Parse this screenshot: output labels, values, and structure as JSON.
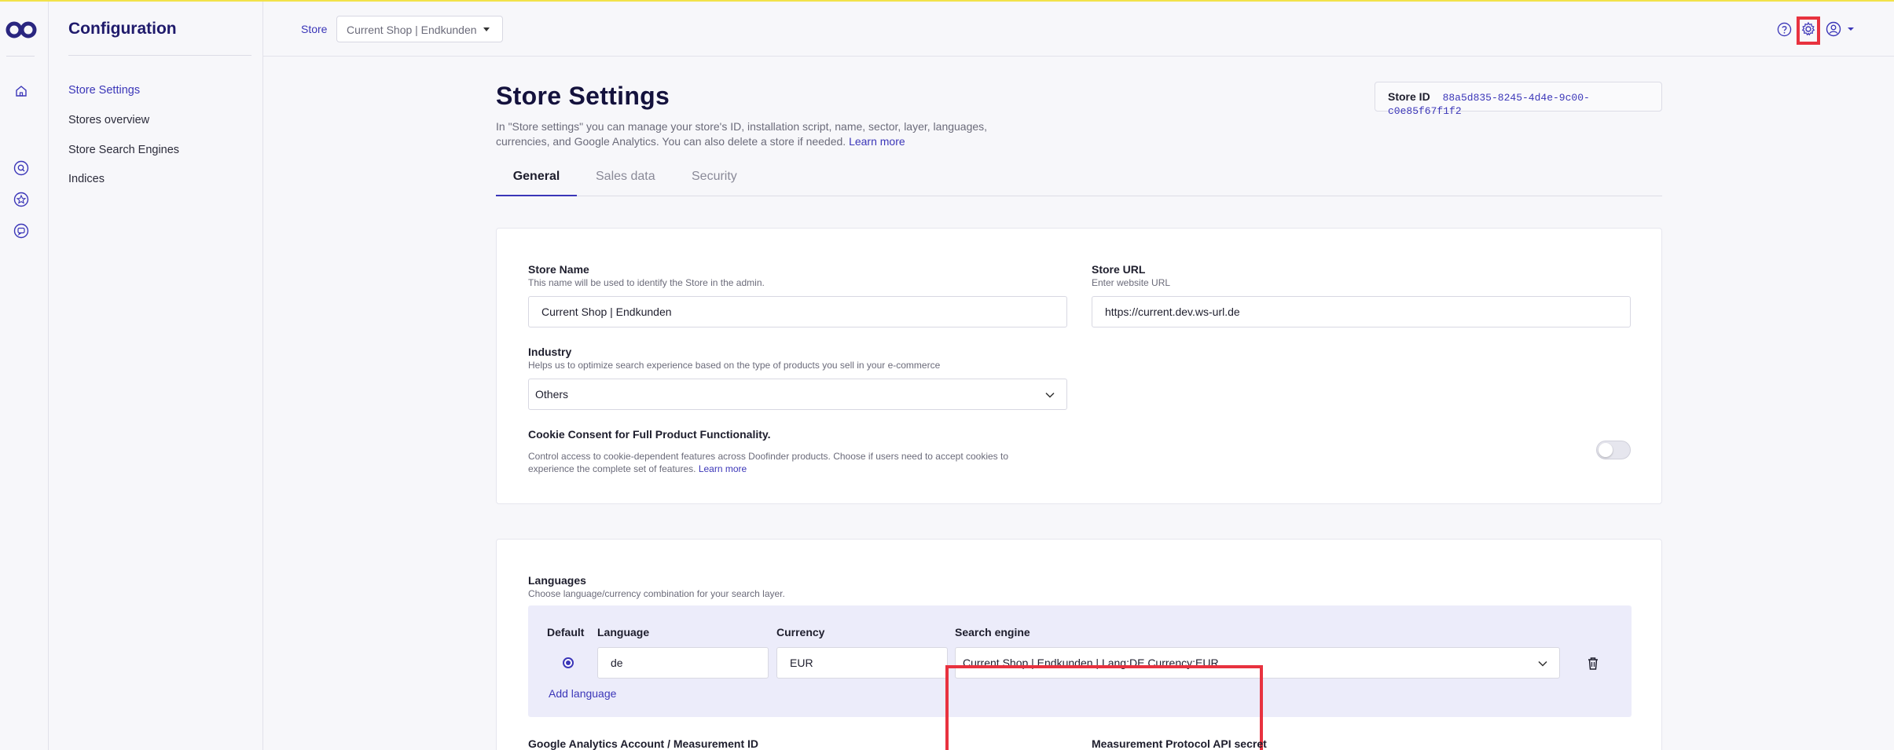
{
  "sidebar_title": "Configuration",
  "sidebar_items": [
    "Store Settings",
    "Stores overview",
    "Store Search Engines",
    "Indices"
  ],
  "header": {
    "store_label": "Store",
    "store_selected": "Current Shop | Endkunden"
  },
  "page": {
    "title": "Store Settings",
    "description": "In \"Store settings\" you can manage your store's ID, installation script, name, sector, layer, languages, currencies, and Google Analytics. You can also delete a store if needed.",
    "learn_more": "Learn more",
    "store_id_label": "Store ID",
    "store_id_value": "88a5d835-8245-4d4e-9c00-c0e85f67f1f2",
    "tabs": [
      "General",
      "Sales data",
      "Security"
    ]
  },
  "general": {
    "store_name_label": "Store Name",
    "store_name_hint": "This name will be used to identify the Store in the admin.",
    "store_name_value": "Current Shop | Endkunden",
    "store_url_label": "Store URL",
    "store_url_hint": "Enter website URL",
    "store_url_value": "https://current.dev.ws-url.de",
    "industry_label": "Industry",
    "industry_hint": "Helps us to optimize search experience based on the type of products you sell in your e-commerce",
    "industry_value": "Others",
    "cookie_label": "Cookie Consent for Full Product Functionality.",
    "cookie_hint_line1": "Control access to cookie-dependent features across Doofinder products. Choose if users need to accept cookies to",
    "cookie_hint_line2": "experience the complete set of features.",
    "cookie_learn_more": "Learn more"
  },
  "languages": {
    "label": "Languages",
    "hint": "Choose language/currency combination for your search layer.",
    "col_default": "Default",
    "col_language": "Language",
    "col_currency": "Currency",
    "col_search_engine": "Search engine",
    "language_value": "de",
    "currency_value": "EUR",
    "search_engine_value": "Current Shop | Endkunden | Lang:DE Currency:EUR",
    "add_language": "Add language"
  },
  "analytics": {
    "ga_label": "Google Analytics Account / Measurement ID",
    "mp_label": "Measurement Protocol API secret"
  },
  "colors": {
    "accent": "#3b36b8",
    "highlight": "#e8323f",
    "title": "#14123d"
  },
  "icons": [
    "doofinder-logo-icon",
    "home-icon",
    "search-icon",
    "star-icon",
    "chat-icon",
    "help-icon",
    "gear-icon",
    "user-icon",
    "chevron-down-icon",
    "trash-icon"
  ]
}
